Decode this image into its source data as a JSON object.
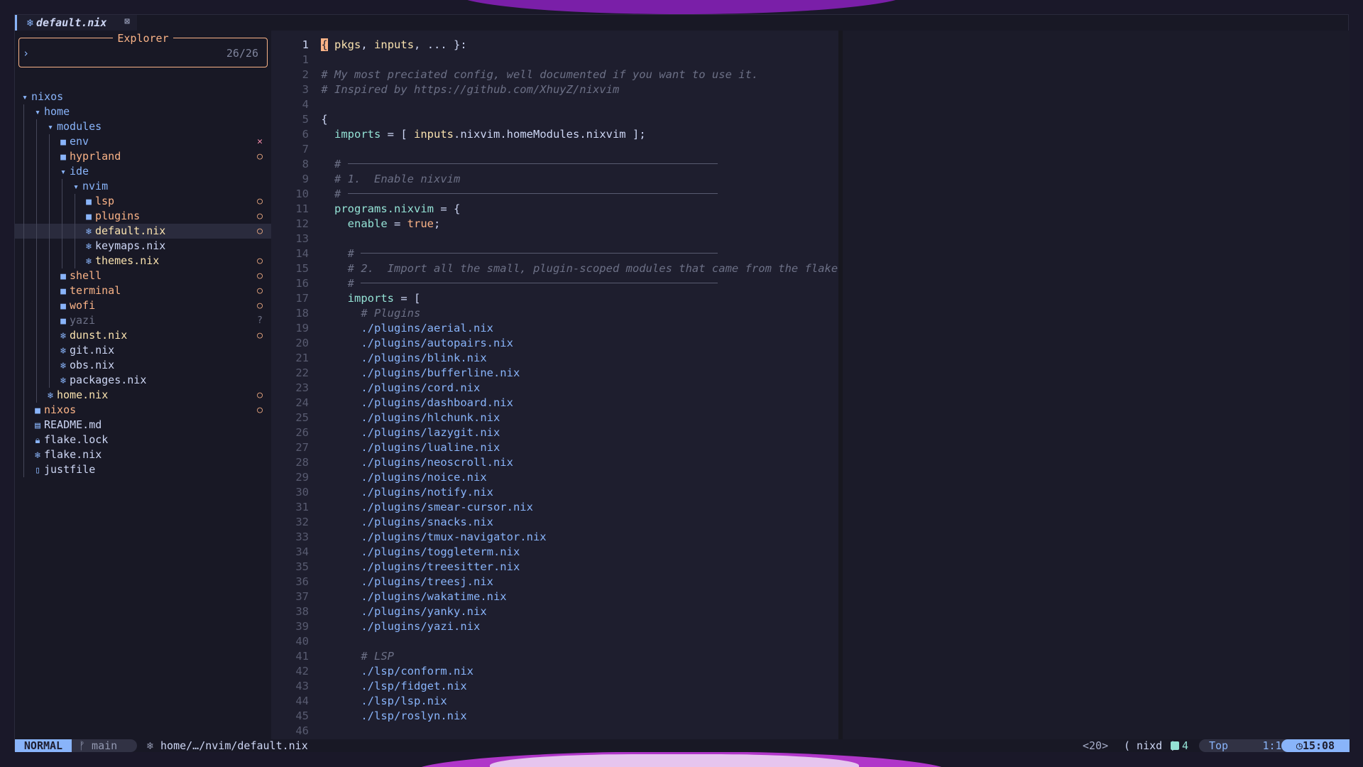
{
  "tab": {
    "icon": "nix-snowflake-icon",
    "title": "default.nix",
    "close_icon": "⊠"
  },
  "explorer": {
    "title": "Explorer",
    "prompt": "›",
    "count": "26/26",
    "tree": [
      {
        "name": "nixos",
        "depth": 0,
        "kind": "dir-open",
        "status": ""
      },
      {
        "name": "home",
        "depth": 1,
        "kind": "dir-open",
        "status": ""
      },
      {
        "name": "modules",
        "depth": 2,
        "kind": "dir-open",
        "status": ""
      },
      {
        "name": "env",
        "depth": 3,
        "kind": "dir",
        "status": "✕"
      },
      {
        "name": "hyprland",
        "depth": 3,
        "kind": "dir",
        "status": "○"
      },
      {
        "name": "ide",
        "depth": 3,
        "kind": "dir-open",
        "status": ""
      },
      {
        "name": "nvim",
        "depth": 4,
        "kind": "dir-open",
        "status": ""
      },
      {
        "name": "lsp",
        "depth": 5,
        "kind": "dir",
        "status": "○"
      },
      {
        "name": "plugins",
        "depth": 5,
        "kind": "dir",
        "status": "○"
      },
      {
        "name": "default.nix",
        "depth": 5,
        "kind": "nix",
        "status": "○",
        "selected": true
      },
      {
        "name": "keymaps.nix",
        "depth": 5,
        "kind": "nix",
        "status": ""
      },
      {
        "name": "themes.nix",
        "depth": 5,
        "kind": "nix",
        "status": "○"
      },
      {
        "name": "shell",
        "depth": 3,
        "kind": "dir",
        "status": "○"
      },
      {
        "name": "terminal",
        "depth": 3,
        "kind": "dir",
        "status": "○"
      },
      {
        "name": "wofi",
        "depth": 3,
        "kind": "dir",
        "status": "○"
      },
      {
        "name": "yazi",
        "depth": 3,
        "kind": "dir",
        "status": "?"
      },
      {
        "name": "dunst.nix",
        "depth": 3,
        "kind": "nix",
        "status": "○"
      },
      {
        "name": "git.nix",
        "depth": 3,
        "kind": "nix",
        "status": ""
      },
      {
        "name": "obs.nix",
        "depth": 3,
        "kind": "nix",
        "status": ""
      },
      {
        "name": "packages.nix",
        "depth": 3,
        "kind": "nix",
        "status": ""
      },
      {
        "name": "home.nix",
        "depth": 2,
        "kind": "nix",
        "status": "○"
      },
      {
        "name": "nixos",
        "depth": 1,
        "kind": "dir",
        "status": "○"
      },
      {
        "name": "README.md",
        "depth": 1,
        "kind": "md",
        "status": ""
      },
      {
        "name": "flake.lock",
        "depth": 1,
        "kind": "lock",
        "status": ""
      },
      {
        "name": "flake.nix",
        "depth": 1,
        "kind": "nix",
        "status": ""
      },
      {
        "name": "justfile",
        "depth": 1,
        "kind": "file",
        "status": ""
      }
    ]
  },
  "code": [
    {
      "n": "1",
      "cur": true,
      "segs": [
        [
          "cursor",
          "{"
        ],
        [
          "a",
          " pkgs"
        ],
        [
          "",
          ", "
        ],
        [
          "a",
          "inputs"
        ],
        [
          "",
          ", ... }:"
        ]
      ]
    },
    {
      "n": "1",
      "segs": []
    },
    {
      "n": "2",
      "segs": [
        [
          "c",
          "# My most preciated config, well documented if you want to use it."
        ]
      ]
    },
    {
      "n": "3",
      "segs": [
        [
          "c",
          "# Inspired by https://github.com/XhuyZ/nixvim"
        ]
      ]
    },
    {
      "n": "4",
      "segs": []
    },
    {
      "n": "5",
      "segs": [
        [
          "",
          "{"
        ]
      ]
    },
    {
      "n": "6",
      "segs": [
        [
          "",
          "  "
        ],
        [
          "k",
          "imports"
        ],
        [
          "",
          " = [ "
        ],
        [
          "a",
          "inputs"
        ],
        [
          "",
          ".nixvim.homeModules.nixvim"
        ],
        [
          "",
          " ];"
        ]
      ]
    },
    {
      "n": "7",
      "segs": []
    },
    {
      "n": "8",
      "rule": 2,
      "segs": [
        [
          "c",
          "  # "
        ]
      ]
    },
    {
      "n": "9",
      "segs": [
        [
          "c",
          "  # 1.  Enable nixvim"
        ]
      ]
    },
    {
      "n": "10",
      "rule": 2,
      "segs": [
        [
          "c",
          "  # "
        ]
      ]
    },
    {
      "n": "11",
      "segs": [
        [
          "",
          "  "
        ],
        [
          "k",
          "programs.nixvim"
        ],
        [
          "",
          " = {"
        ]
      ]
    },
    {
      "n": "12",
      "segs": [
        [
          "",
          "    "
        ],
        [
          "k",
          "enable"
        ],
        [
          "",
          " = "
        ],
        [
          "b",
          "true"
        ],
        [
          "",
          ";"
        ]
      ]
    },
    {
      "n": "13",
      "segs": []
    },
    {
      "n": "14",
      "rule": 4,
      "segs": [
        [
          "c",
          "    # "
        ]
      ]
    },
    {
      "n": "15",
      "segs": [
        [
          "c",
          "    # 2.  Import all the small, plugin-scoped modules that came from the flake"
        ]
      ]
    },
    {
      "n": "16",
      "rule": 4,
      "segs": [
        [
          "c",
          "    # "
        ]
      ]
    },
    {
      "n": "17",
      "segs": [
        [
          "",
          "    "
        ],
        [
          "k",
          "imports"
        ],
        [
          "",
          " = ["
        ]
      ]
    },
    {
      "n": "18",
      "segs": [
        [
          "c",
          "      # Plugins"
        ]
      ]
    },
    {
      "n": "19",
      "segs": [
        [
          "",
          "      "
        ],
        [
          "p",
          "./plugins/aerial.nix"
        ]
      ]
    },
    {
      "n": "20",
      "segs": [
        [
          "",
          "      "
        ],
        [
          "p",
          "./plugins/autopairs.nix"
        ]
      ]
    },
    {
      "n": "21",
      "segs": [
        [
          "",
          "      "
        ],
        [
          "p",
          "./plugins/blink.nix"
        ]
      ]
    },
    {
      "n": "22",
      "segs": [
        [
          "",
          "      "
        ],
        [
          "p",
          "./plugins/bufferline.nix"
        ]
      ]
    },
    {
      "n": "23",
      "segs": [
        [
          "",
          "      "
        ],
        [
          "p",
          "./plugins/cord.nix"
        ]
      ]
    },
    {
      "n": "24",
      "segs": [
        [
          "",
          "      "
        ],
        [
          "p",
          "./plugins/dashboard.nix"
        ]
      ]
    },
    {
      "n": "25",
      "segs": [
        [
          "",
          "      "
        ],
        [
          "p",
          "./plugins/hlchunk.nix"
        ]
      ]
    },
    {
      "n": "26",
      "segs": [
        [
          "",
          "      "
        ],
        [
          "p",
          "./plugins/lazygit.nix"
        ]
      ]
    },
    {
      "n": "27",
      "segs": [
        [
          "",
          "      "
        ],
        [
          "p",
          "./plugins/lualine.nix"
        ]
      ]
    },
    {
      "n": "28",
      "segs": [
        [
          "",
          "      "
        ],
        [
          "p",
          "./plugins/neoscroll.nix"
        ]
      ]
    },
    {
      "n": "29",
      "segs": [
        [
          "",
          "      "
        ],
        [
          "p",
          "./plugins/noice.nix"
        ]
      ]
    },
    {
      "n": "30",
      "segs": [
        [
          "",
          "      "
        ],
        [
          "p",
          "./plugins/notify.nix"
        ]
      ]
    },
    {
      "n": "31",
      "segs": [
        [
          "",
          "      "
        ],
        [
          "p",
          "./plugins/smear-cursor.nix"
        ]
      ]
    },
    {
      "n": "32",
      "segs": [
        [
          "",
          "      "
        ],
        [
          "p",
          "./plugins/snacks.nix"
        ]
      ]
    },
    {
      "n": "33",
      "segs": [
        [
          "",
          "      "
        ],
        [
          "p",
          "./plugins/tmux-navigator.nix"
        ]
      ]
    },
    {
      "n": "34",
      "segs": [
        [
          "",
          "      "
        ],
        [
          "p",
          "./plugins/toggleterm.nix"
        ]
      ]
    },
    {
      "n": "35",
      "segs": [
        [
          "",
          "      "
        ],
        [
          "p",
          "./plugins/treesitter.nix"
        ]
      ]
    },
    {
      "n": "36",
      "segs": [
        [
          "",
          "      "
        ],
        [
          "p",
          "./plugins/treesj.nix"
        ]
      ]
    },
    {
      "n": "37",
      "segs": [
        [
          "",
          "      "
        ],
        [
          "p",
          "./plugins/wakatime.nix"
        ]
      ]
    },
    {
      "n": "38",
      "segs": [
        [
          "",
          "      "
        ],
        [
          "p",
          "./plugins/yanky.nix"
        ]
      ]
    },
    {
      "n": "39",
      "segs": [
        [
          "",
          "      "
        ],
        [
          "p",
          "./plugins/yazi.nix"
        ]
      ]
    },
    {
      "n": "40",
      "segs": []
    },
    {
      "n": "41",
      "segs": [
        [
          "c",
          "      # LSP"
        ]
      ]
    },
    {
      "n": "42",
      "segs": [
        [
          "",
          "      "
        ],
        [
          "p",
          "./lsp/conform.nix"
        ]
      ]
    },
    {
      "n": "43",
      "segs": [
        [
          "",
          "      "
        ],
        [
          "p",
          "./lsp/fidget.nix"
        ]
      ]
    },
    {
      "n": "44",
      "segs": [
        [
          "",
          "      "
        ],
        [
          "p",
          "./lsp/lsp.nix"
        ]
      ]
    },
    {
      "n": "45",
      "segs": [
        [
          "",
          "      "
        ],
        [
          "p",
          "./lsp/roslyn.nix"
        ]
      ]
    },
    {
      "n": "46",
      "segs": []
    }
  ],
  "status": {
    "mode": "NORMAL",
    "branch_icon": "ᚠ",
    "branch": "main",
    "file_icon": "nix-snowflake-icon",
    "path": "home/…/nvim/default.nix",
    "keys": "<20>",
    "lsp": "( nixd (",
    "diagnostics": "4",
    "position": "Top",
    "location": "1:1",
    "time": "15:08"
  },
  "colors": {
    "accent": "#89b4fa",
    "explorer_border": "#fab387",
    "modified": "#f9e2af",
    "error": "#f38ba8"
  }
}
